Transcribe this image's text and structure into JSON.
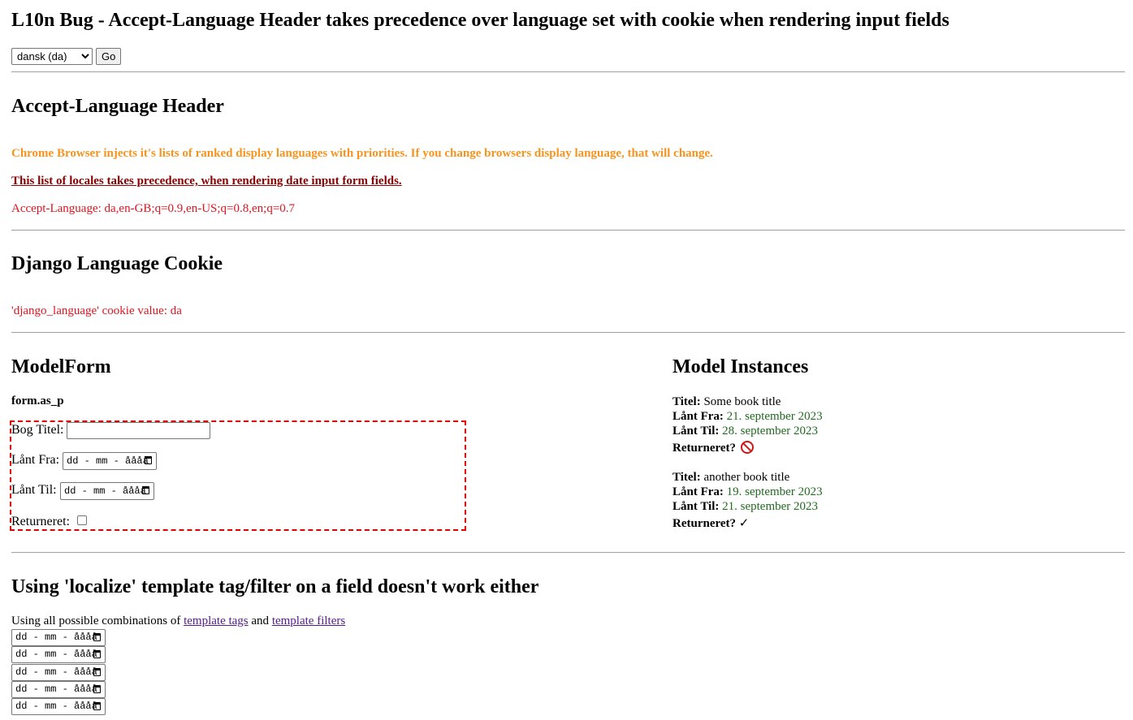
{
  "header": {
    "title": "L10n Bug - Accept-Language Header takes precedence over language set with cookie when rendering input fields",
    "language_select": {
      "selected": "dansk (da)"
    },
    "go_label": "Go"
  },
  "accept_language": {
    "heading": "Accept-Language Header",
    "info": "Chrome Browser injects it's lists of ranked display languages with priorities. If you change browsers display language, that will change.",
    "warning": "This list of locales takes precedence, when rendering date input form fields.",
    "value_line": "Accept-Language: da,en-GB;q=0.9,en-US;q=0.8,en;q=0.7"
  },
  "cookie": {
    "heading": "Django Language Cookie",
    "value_line": "'django_language' cookie value: da"
  },
  "model_form": {
    "heading": "ModelForm",
    "subheading": "form.as_p",
    "fields": {
      "title_label": "Bog Titel:",
      "title_value": "",
      "from_label": "Lånt Fra:",
      "from_placeholder": "dd - mm - åååå",
      "to_label": "Lånt Til:",
      "to_placeholder": "dd - mm - åååå",
      "returned_label": "Returneret:"
    }
  },
  "model_instances": {
    "heading": "Model Instances",
    "items": [
      {
        "title_label": "Titel:",
        "title": "Some book title",
        "from_label": "Lånt Fra:",
        "from": "21. september 2023",
        "to_label": "Lånt Til:",
        "to": "28. september 2023",
        "returned_label": "Returneret?",
        "returned_icon": "no-entry-icon"
      },
      {
        "title_label": "Titel:",
        "title": "another book title",
        "from_label": "Lånt Fra:",
        "from": "19. september 2023",
        "to_label": "Lånt Til:",
        "to": "21. september 2023",
        "returned_label": "Returneret?",
        "returned_icon": "check-mark-icon",
        "returned_glyph": "✓"
      }
    ]
  },
  "localize": {
    "heading": "Using 'localize' template tag/filter on a field doesn't work either",
    "intro_prefix": "Using all possible combinations of",
    "link_tags": "template tags",
    "intro_and": "and",
    "link_filters": "template filters",
    "date_placeholder": "dd - mm - åååå"
  },
  "colors": {
    "info": "#f7931e",
    "warning": "#8b0000",
    "value": "#e0141e",
    "date_value": "#1f6b1f",
    "form_border": "#e00000",
    "link": "#551a8b"
  }
}
